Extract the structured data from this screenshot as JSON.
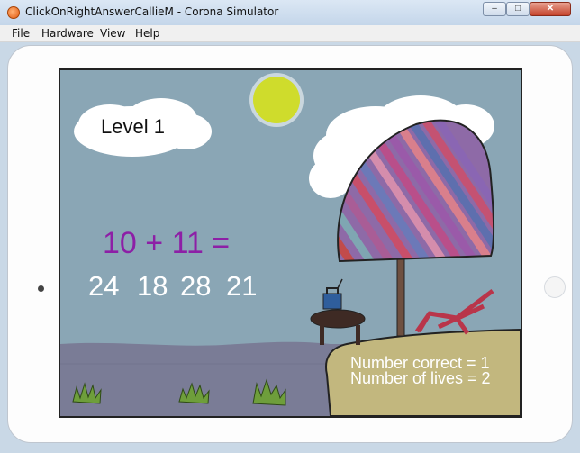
{
  "window": {
    "title": "ClickOnRightAnswerCallieM - Corona Simulator",
    "minimize": "–",
    "maximize": "□",
    "close": "✕"
  },
  "menu": {
    "items": [
      {
        "label": "File"
      },
      {
        "label": "Hardware"
      },
      {
        "label": "View"
      },
      {
        "label": "Help"
      }
    ]
  },
  "game": {
    "level": "Level 1",
    "question": "10 + 11 =",
    "answers": [
      "24",
      "18",
      "28",
      "21"
    ],
    "correct_text": "Number correct = 1",
    "lives_text": "Number of lives = 2",
    "colors": {
      "sky": "#8aa6b5",
      "question": "#8d1fa6",
      "sun": "#cfdc2c",
      "sand": "#c2b77e",
      "hills": "#7a7c96"
    }
  },
  "icons": {
    "app": "corona-app-icon",
    "sun": "sun-icon",
    "umbrella": "umbrella-icon",
    "chair": "beach-chair-icon",
    "radio": "radio-icon",
    "table": "table-icon",
    "plants": "grass-tuft-icon"
  }
}
